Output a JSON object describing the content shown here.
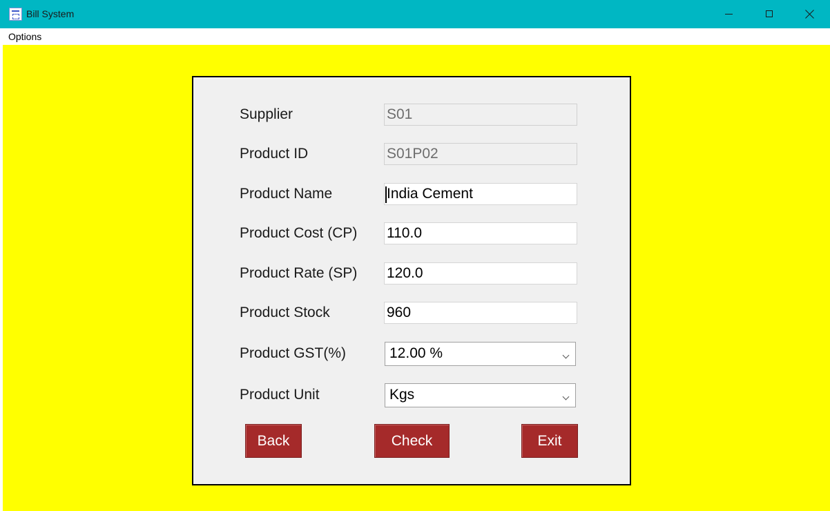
{
  "window": {
    "title": "Bill System",
    "icon": "app-logo-icon",
    "controls": [
      "minimize-icon",
      "maximize-icon",
      "close-icon"
    ]
  },
  "menu": {
    "options_label": "Options"
  },
  "colors": {
    "titlebar": "#00b7c3",
    "background": "#ffff00",
    "panel": "#f0f0f0",
    "button": "#a52a2a"
  },
  "form": {
    "supplier": {
      "label": "Supplier",
      "value": "S01"
    },
    "product_id": {
      "label": "Product ID",
      "value": "S01P02"
    },
    "product_name": {
      "label": "Product Name",
      "value": "India Cement"
    },
    "product_cost": {
      "label": "Product Cost (CP)",
      "value": "110.0"
    },
    "product_rate": {
      "label": "Product Rate (SP)",
      "value": "120.0"
    },
    "product_stock": {
      "label": "Product Stock",
      "value": "960"
    },
    "product_gst": {
      "label": "Product GST(%)",
      "selected": "12.00 %"
    },
    "product_unit": {
      "label": "Product Unit",
      "selected": "Kgs"
    }
  },
  "buttons": {
    "back": "Back",
    "check": "Check",
    "exit": "Exit"
  }
}
